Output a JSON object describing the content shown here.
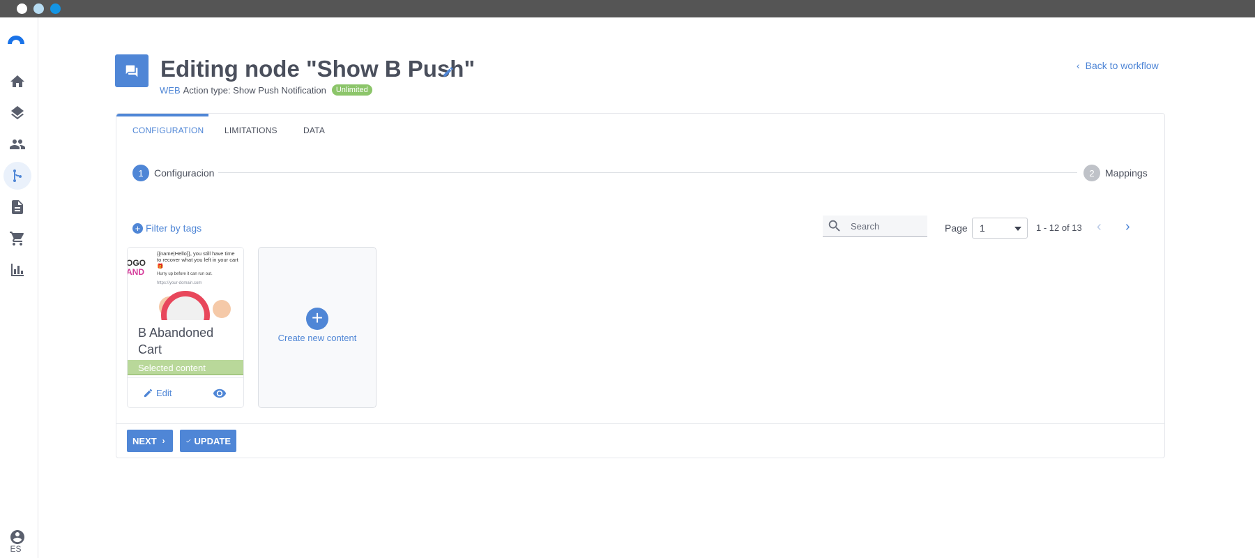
{
  "window": {
    "controls": [
      "close",
      "minimize",
      "zoom"
    ]
  },
  "sidebar": {
    "items": [
      {
        "name": "home",
        "icon": "home-icon"
      },
      {
        "name": "layers",
        "icon": "layers-icon"
      },
      {
        "name": "people",
        "icon": "people-icon"
      },
      {
        "name": "workflow",
        "icon": "workflow-icon",
        "active": true
      },
      {
        "name": "document",
        "icon": "document-icon"
      },
      {
        "name": "cart",
        "icon": "cart-icon"
      },
      {
        "name": "chart",
        "icon": "bar-chart-icon"
      }
    ],
    "language": "ES"
  },
  "header": {
    "title": "Editing node \"Show B Push\"",
    "channel": "WEB",
    "action_type": "Action type: Show Push Notification",
    "badge": "Unlimited",
    "back_link": "Back to workflow"
  },
  "tabs": [
    {
      "label": "CONFIGURATION",
      "active": true
    },
    {
      "label": "LIMITATIONS"
    },
    {
      "label": "DATA"
    }
  ],
  "stepper": {
    "steps": [
      {
        "number": "1",
        "label": "Configuracion",
        "active": true
      },
      {
        "number": "2",
        "label": "Mappings"
      }
    ]
  },
  "filters": {
    "filter_by_tags": "Filter by tags",
    "search_placeholder": "Search",
    "page_label": "Page",
    "page_value": "1",
    "range": "1 - 12 of 13"
  },
  "content": {
    "items": [
      {
        "name": "B Abandoned Cart",
        "status": "Selected content",
        "edit_label": "Edit",
        "preview": {
          "logo_top": "OGO",
          "logo_bottom": "AND",
          "text": "{{name|Hello}}, you still have time to recover what you left in your cart 🎁",
          "subtext": "Hurry up before it can run out.",
          "url": "https://your-domain.com"
        }
      }
    ],
    "create_label": "Create new content"
  },
  "footer": {
    "next_label": "NEXT",
    "update_label": "UPDATE"
  },
  "colors": {
    "accent": "#4f86d6",
    "badge": "#8cc56a",
    "selected": "#b9d89a",
    "titlebar": "#555555"
  }
}
